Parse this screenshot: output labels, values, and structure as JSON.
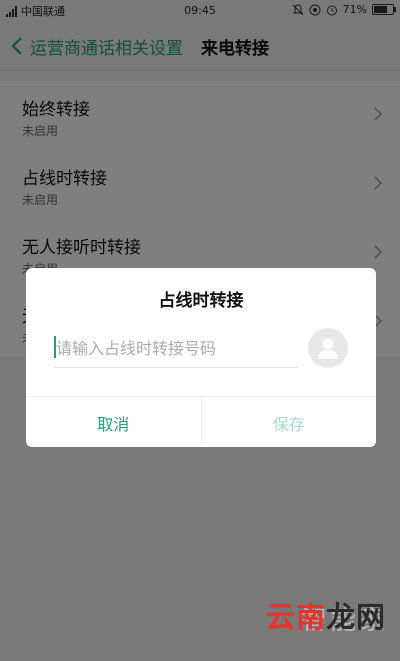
{
  "status_bar": {
    "carrier": "中国联通",
    "time": "09:45",
    "battery_percent": "71%",
    "battery_level": 0.71
  },
  "header": {
    "back_label": "运营商通话相关设置",
    "title": "来电转接"
  },
  "settings": {
    "items": [
      {
        "title": "始终转接",
        "status": "未启用"
      },
      {
        "title": "占线时转接",
        "status": "未启用"
      },
      {
        "title": "无人接听时转接",
        "status": "未启用"
      },
      {
        "title": "无",
        "status": "未"
      }
    ]
  },
  "dialog": {
    "title": "占线时转接",
    "input_value": "",
    "input_placeholder": "请输入占线时转接号码",
    "cancel_label": "取消",
    "save_label": "保存"
  },
  "colors": {
    "accent": "#20a179",
    "accent_disabled": "#a5d9c5"
  },
  "watermark": {
    "main_red": "云南",
    "main_dark": "龙网",
    "brand": "智能家"
  }
}
